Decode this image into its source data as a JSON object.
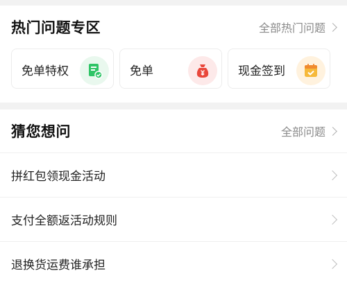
{
  "hot": {
    "title": "热门问题专区",
    "more_label": "全部热门问题",
    "tiles": [
      {
        "label": "免单特权",
        "icon": "green-check-doc-icon"
      },
      {
        "label": "免单",
        "icon": "red-money-bag-icon"
      },
      {
        "label": "现金签到",
        "icon": "yellow-calendar-check-icon"
      }
    ]
  },
  "guess": {
    "title": "猜您想问",
    "more_label": "全部问题",
    "items": [
      {
        "label": "拼红包领现金活动"
      },
      {
        "label": "支付全额返活动规则"
      },
      {
        "label": "退换货运费谁承担"
      }
    ]
  },
  "colors": {
    "green": "#2fc466",
    "red": "#e9473b",
    "yellow": "#f6b93a",
    "muted": "#8a8a8a"
  }
}
